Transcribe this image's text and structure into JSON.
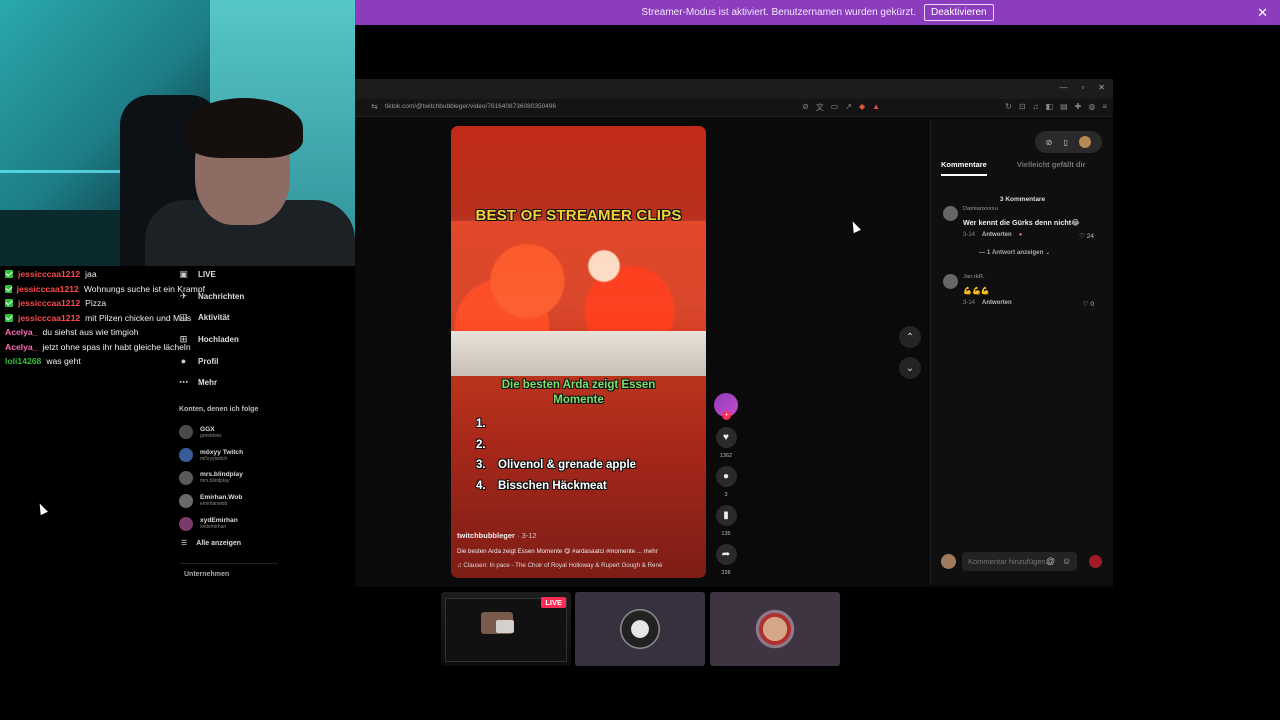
{
  "banner": {
    "text": "Streamer-Modus ist aktiviert. Benutzernamen wurden gekürzt.",
    "button": "Deaktivieren",
    "close": "✕"
  },
  "chat": [
    {
      "badge": true,
      "user": "jessicccaa1212",
      "msg": "jaa",
      "color": "#ff4a4a"
    },
    {
      "badge": true,
      "user": "jessicccaa1212",
      "msg": "Wohnungs suche ist ein Krampf",
      "color": "#ff4a4a"
    },
    {
      "badge": true,
      "user": "jessicccaa1212",
      "msg": "Pizza",
      "color": "#ff4a4a"
    },
    {
      "badge": true,
      "user": "jessicccaa1212",
      "msg": "mit Pilzen chicken und Mais",
      "color": "#ff4a4a"
    },
    {
      "badge": false,
      "user": "Acelya_",
      "msg": "du siehst aus wie timgioh",
      "color": "#ff69b4"
    },
    {
      "badge": false,
      "user": "Acelya_",
      "msg": "jetzt ohne spas ihr habt gleiche lächeln",
      "color": "#ff69b4"
    },
    {
      "badge": false,
      "user": "loli14268",
      "msg": "was geht",
      "color": "#2fbf3a"
    }
  ],
  "nav": [
    {
      "icon": "live-icon",
      "glyph": "▣",
      "label": "LIVE"
    },
    {
      "icon": "messages-icon",
      "glyph": "✈",
      "label": "Nachrichten"
    },
    {
      "icon": "activity-icon",
      "glyph": "◫",
      "label": "Aktivität"
    },
    {
      "icon": "upload-icon",
      "glyph": "⊞",
      "label": "Hochladen"
    },
    {
      "icon": "profile-icon",
      "glyph": "●",
      "label": "Profil"
    },
    {
      "icon": "more-icon",
      "glyph": "⋯",
      "label": "Mehr"
    }
  ],
  "following": {
    "heading": "Konten, denen ich folge",
    "items": [
      {
        "name": "GGX",
        "handle": "greektoks"
      },
      {
        "name": "möxyy Twitch",
        "handle": "m0xyytwitch"
      },
      {
        "name": "mrs.blindplay",
        "handle": "mrs.blindplay"
      },
      {
        "name": "Emirhan.Wob",
        "handle": "emirhanwob"
      },
      {
        "name": "xydEmirhan",
        "handle": "xedemirhan"
      }
    ],
    "show_all": "Alle anzeigen",
    "company": "Unternehmen"
  },
  "browser": {
    "url": "tiktok.com/@twitchbubbleger/video/7616408736080350496",
    "window_controls": [
      "—",
      "▫",
      "✕"
    ]
  },
  "video": {
    "title": "BEST OF STREAMER CLIPS",
    "subtitle": "Die besten Arda zeigt Essen Momente",
    "list": [
      {
        "n": "1.",
        "t": ""
      },
      {
        "n": "2.",
        "t": ""
      },
      {
        "n": "3.",
        "t": "Olivenol & grenade apple"
      },
      {
        "n": "4.",
        "t": "Bisschen Häckmeat"
      }
    ],
    "author": "twitchbubbleger",
    "date": " · 3-12",
    "description": "Die besten Arda zeigt Essen Momente 😋 #ardasaatci #momente ...  mehr",
    "music": "♫  Clausen: In pace - The Choir of Royal Holloway & Rupert Gough & René"
  },
  "actions": {
    "likes": "1362",
    "comments": "3",
    "saves": "135",
    "shares": "328"
  },
  "comments": {
    "tab_active": "Kommentare",
    "tab_other": "Vielleicht gefällt dir",
    "count": "3 Kommentare",
    "items": [
      {
        "user": "Damianxxxxu",
        "text": "Wer kennt die Gürks denn nicht😂",
        "date": "3-14",
        "reply": "Antworten",
        "likes": "♡ 24",
        "replies": "— 1 Antwort anzeigen ⌄"
      },
      {
        "user": "Jan.rkR.",
        "text": "💪💪💪",
        "date": "3-14",
        "reply": "Antworten",
        "likes": "♡ 0",
        "replies": ""
      }
    ],
    "input_placeholder": "Kommentar hinzufügen..."
  },
  "live_thumbs": {
    "live_label": "LIVE"
  },
  "colors": {
    "banner": "#8b3dbd",
    "accent": "#fe2c55",
    "title_yellow": "#f4d13a",
    "subtitle_green": "#79e06a"
  }
}
